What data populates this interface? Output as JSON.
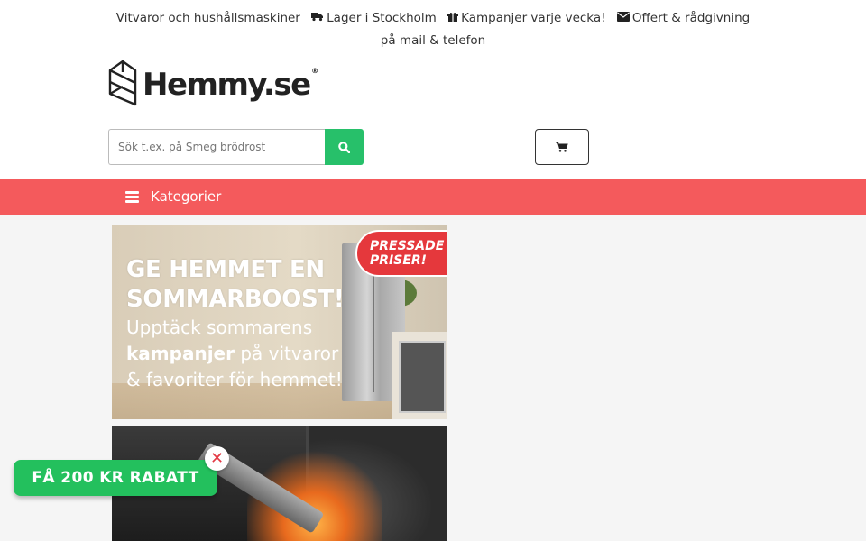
{
  "topbar": {
    "item1": "Vitvaror och hushållsmaskiner",
    "item2": "Lager i Stockholm",
    "item3": "Kampanjer varje vecka!",
    "item4": "Offert & rådgivning på mail & telefon",
    "icons": [
      "truck-icon",
      "gift-icon",
      "envelope-icon"
    ]
  },
  "logo": {
    "text": "Hemmy.se",
    "reg": "®"
  },
  "search": {
    "placeholder": "Sök t.ex. på Smeg brödrost",
    "value": "",
    "button_icon": "search-icon"
  },
  "cart": {
    "icon": "cart-icon"
  },
  "nav": {
    "categories_label": "Kategorier",
    "bg_color": "#f45a5c"
  },
  "banners": {
    "banner1": {
      "badge_line1": "PRESSADE",
      "badge_line2": "PRISER!",
      "heading_line1": "GE HEMMET EN",
      "heading_line2": "SOMMARBOOST!",
      "sub_line1": "Upptäck sommarens",
      "sub_bold": "kampanjer",
      "sub_line2_rest": " på vitvaror",
      "sub_line3": "& favoriter för hemmet!"
    }
  },
  "promo": {
    "label": "FÅ 200 KR RABATT",
    "close": "✕",
    "color": "#23c05d"
  }
}
